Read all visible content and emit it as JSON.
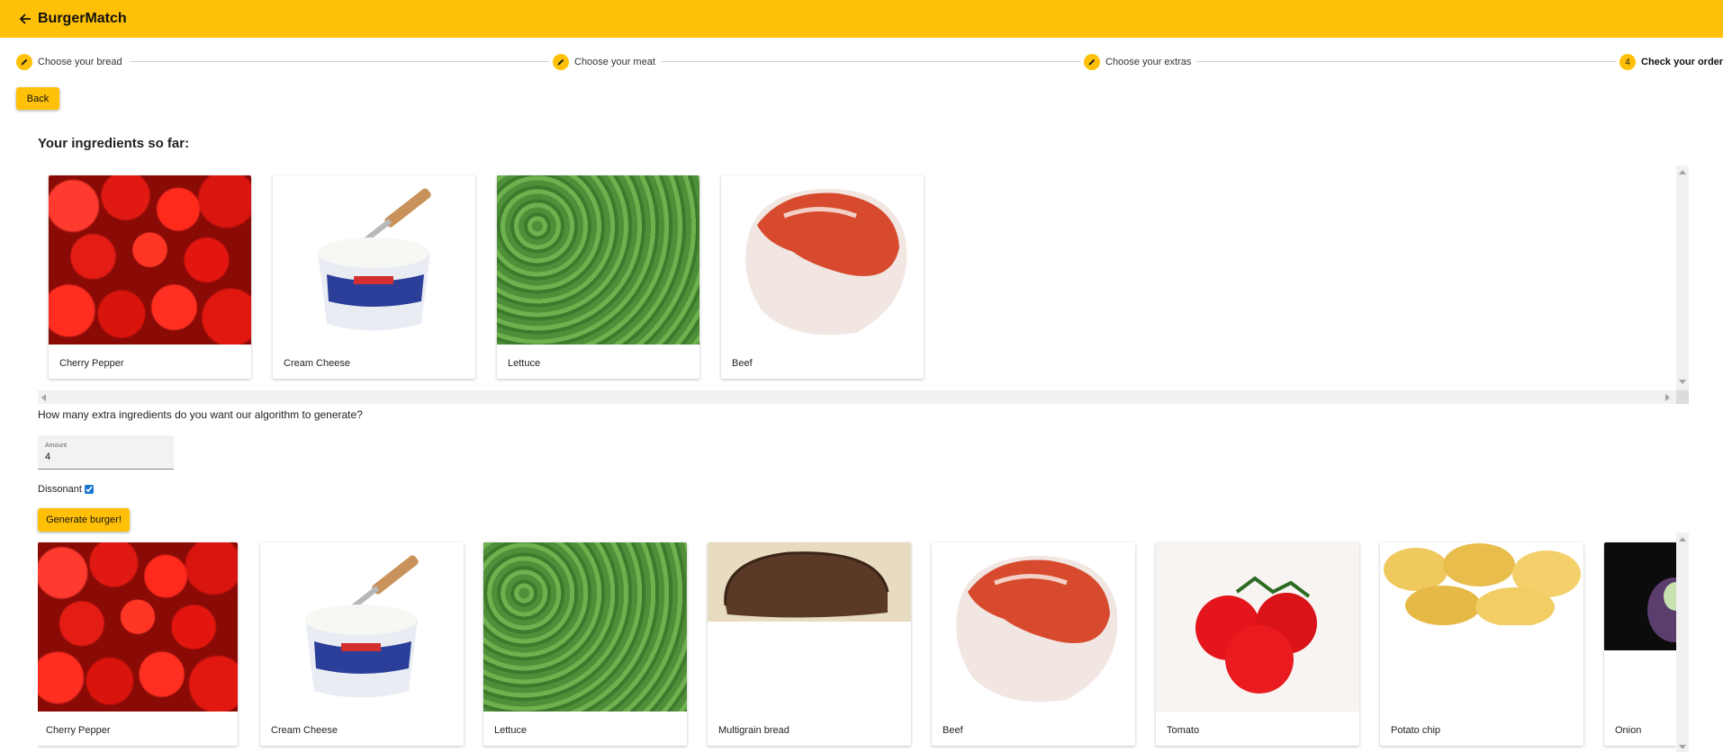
{
  "app": {
    "title": "BurgerMatch"
  },
  "stepper": {
    "steps": [
      {
        "label": "Choose your bread",
        "marker": ""
      },
      {
        "label": "Choose your meat",
        "marker": ""
      },
      {
        "label": "Choose your extras",
        "marker": ""
      },
      {
        "label": "Check your order",
        "marker": "4"
      }
    ]
  },
  "back_button": "Back",
  "ingredients_heading": "Your ingredients so far:",
  "ingredients": [
    {
      "name": "Cherry Pepper"
    },
    {
      "name": "Cream Cheese"
    },
    {
      "name": "Lettuce"
    },
    {
      "name": "Beef"
    }
  ],
  "extra_question": "How many extra ingredients do you want our algorithm to generate?",
  "amount": {
    "label": "Amount",
    "value": "4"
  },
  "dissonant": {
    "label": "Dissonant",
    "checked": true
  },
  "generate_button": "Generate burger!",
  "generated": [
    {
      "name": "Cherry Pepper"
    },
    {
      "name": "Cream Cheese"
    },
    {
      "name": "Lettuce"
    },
    {
      "name": "Multigrain bread"
    },
    {
      "name": "Beef"
    },
    {
      "name": "Tomato"
    },
    {
      "name": "Potato chip"
    },
    {
      "name": "Onion"
    }
  ],
  "colors": {
    "accent": "#ffc107"
  },
  "icons": {
    "back": "arrow-left-icon",
    "edit": "pencil-icon"
  }
}
